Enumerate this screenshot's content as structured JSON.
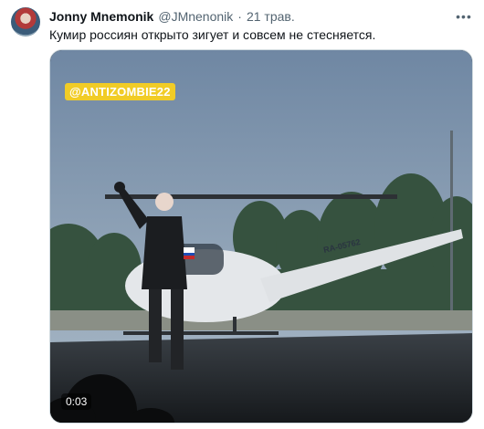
{
  "tweet": {
    "author_name": "Jonny Mnemonik",
    "handle": "@JMnenonik",
    "separator": "·",
    "time": "21 трав.",
    "more_label": "•••",
    "text": "Кумир россиян открыто зигует и совсем не стесняется."
  },
  "media": {
    "watermark": "@ANTIZOMBIE22",
    "timestamp": "0:03",
    "helicopter_registration": "RA-05762"
  },
  "colors": {
    "sky": "#7f95ad",
    "trees": "#35513d",
    "stage": "#1f2326",
    "helicopter": "#e4e7ea",
    "watermark_bg": "#f1cc26"
  }
}
